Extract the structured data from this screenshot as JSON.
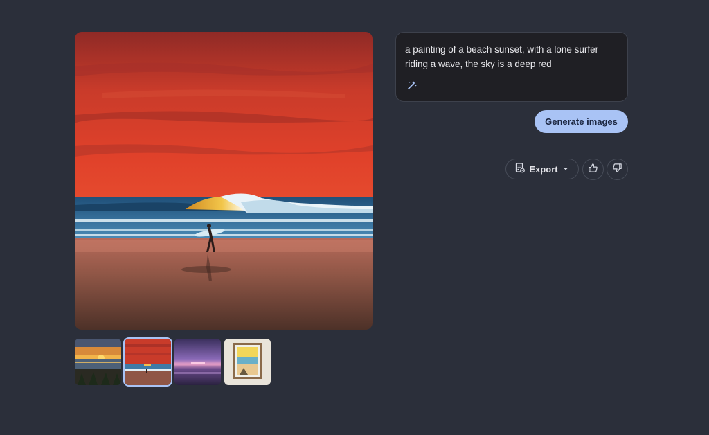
{
  "prompt": {
    "text": "a painting of a beach sunset, with a lone surfer riding a wave, the sky is a deep red",
    "edit_icon": "magic-wand-icon"
  },
  "actions": {
    "generate_label": "Generate images",
    "export_label": "Export",
    "export_icon": "document-export-icon",
    "dropdown_icon": "caret-down-icon",
    "thumbs_up_icon": "thumbs-up-icon",
    "thumbs_down_icon": "thumbs-down-icon"
  },
  "gallery": {
    "selected_index": 1,
    "thumbnails": [
      {
        "subject": "sunset-palms"
      },
      {
        "subject": "red-sky-surfer"
      },
      {
        "subject": "purple-sunset"
      },
      {
        "subject": "framed-painting"
      }
    ]
  },
  "colors": {
    "background": "#2b2f3a",
    "accent": "#a9c3f5",
    "panel": "#1f1f24"
  }
}
